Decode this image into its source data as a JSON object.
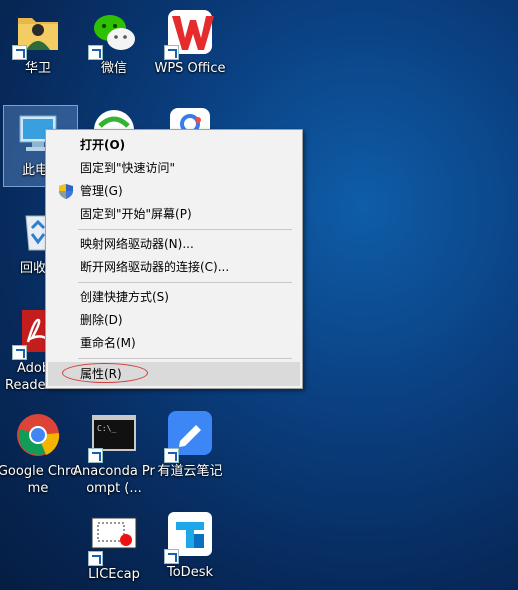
{
  "desktop": {
    "icons": [
      {
        "label": "华卫"
      },
      {
        "label": "微信"
      },
      {
        "label": "WPS Office"
      },
      {
        "label": "此电脑"
      },
      {
        "label": "回收站"
      },
      {
        "label": "Adobe Reader"
      },
      {
        "label": "Google Chrome"
      },
      {
        "label": "Anaconda Prompt (..."
      },
      {
        "label": "有道云笔记"
      },
      {
        "label": "LICEcap"
      },
      {
        "label": "ToDesk"
      }
    ],
    "partial_labels": {
      "this_pc": "此电",
      "recycle": "回收",
      "adobe1": "Adob",
      "adobe2": "Reade"
    }
  },
  "context_menu": {
    "items": {
      "open": "打开(O)",
      "pin_quick": "固定到\"快速访问\"",
      "manage": "管理(G)",
      "pin_start": "固定到\"开始\"屏幕(P)",
      "map_drive": "映射网络驱动器(N)...",
      "disconnect_drive": "断开网络驱动器的连接(C)...",
      "create_shortcut": "创建快捷方式(S)",
      "delete": "删除(D)",
      "rename": "重命名(M)",
      "properties": "属性(R)"
    }
  },
  "colors": {
    "desktop_bg": "#0a3f80",
    "menu_bg": "#f2f2f2",
    "highlight_ellipse": "#d23a3a"
  }
}
